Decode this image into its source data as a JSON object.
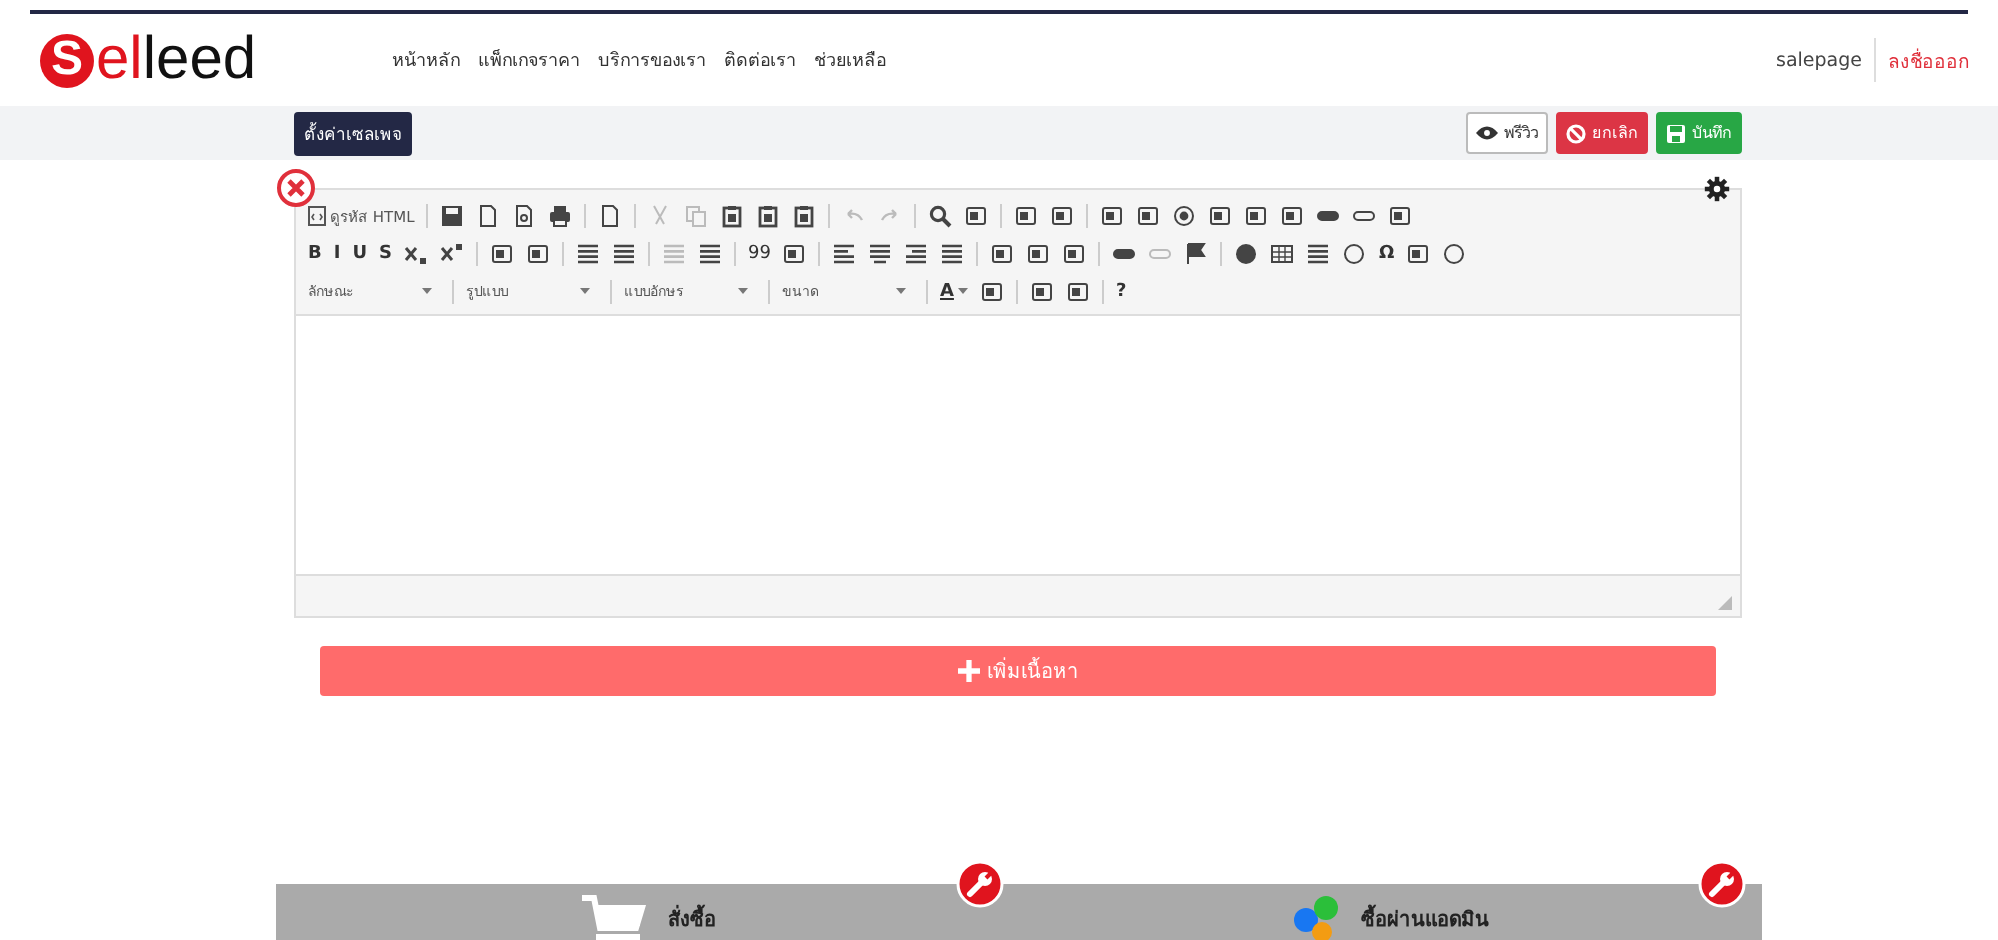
{
  "logo": {
    "badge": "S",
    "accent": "el",
    "rest": "leed"
  },
  "nav": [
    "หน้าหลัก",
    "แพ็กเกจราคา",
    "บริการของเรา",
    "ติดต่อเรา",
    "ช่วยเหลือ"
  ],
  "account": {
    "user": "salepage",
    "logout": "ลงชื่อออก"
  },
  "toolbar_bar": {
    "settings": "ตั้งค่าเซลเพจ",
    "actions": [
      {
        "kind": "preview",
        "label": "พรีวิว"
      },
      {
        "kind": "cancel",
        "label": "ยกเลิก"
      },
      {
        "kind": "save",
        "label": "บันทึก"
      }
    ]
  },
  "editor": {
    "rows": [
      [
        {
          "kind": "source",
          "label": "ดูรหัส HTML"
        },
        {
          "kind": "sep"
        },
        {
          "kind": "icon"
        },
        {
          "kind": "icon"
        },
        {
          "kind": "icon"
        },
        {
          "kind": "icon"
        },
        {
          "kind": "sep"
        },
        {
          "kind": "icon"
        },
        {
          "kind": "sep"
        },
        {
          "kind": "icon",
          "disabled": true
        },
        {
          "kind": "icon",
          "disabled": true
        },
        {
          "kind": "icon"
        },
        {
          "kind": "icon"
        },
        {
          "kind": "icon"
        },
        {
          "kind": "sep"
        },
        {
          "kind": "icon",
          "disabled": true
        },
        {
          "kind": "icon",
          "disabled": true
        },
        {
          "kind": "sep"
        },
        {
          "kind": "icon"
        },
        {
          "kind": "icon"
        },
        {
          "kind": "sep"
        },
        {
          "kind": "icon"
        },
        {
          "kind": "icon"
        },
        {
          "kind": "sep"
        },
        {
          "kind": "icon"
        },
        {
          "kind": "icon"
        },
        {
          "kind": "icon"
        },
        {
          "kind": "icon"
        },
        {
          "kind": "icon"
        },
        {
          "kind": "icon"
        },
        {
          "kind": "icon"
        },
        {
          "kind": "icon"
        },
        {
          "kind": "icon"
        }
      ],
      [
        {
          "kind": "text",
          "label": "B"
        },
        {
          "kind": "text",
          "label": "I"
        },
        {
          "kind": "text",
          "label": "U"
        },
        {
          "kind": "text",
          "label": "S"
        },
        {
          "kind": "icon"
        },
        {
          "kind": "icon"
        },
        {
          "kind": "sep"
        },
        {
          "kind": "icon"
        },
        {
          "kind": "icon"
        },
        {
          "kind": "sep"
        },
        {
          "kind": "icon"
        },
        {
          "kind": "icon"
        },
        {
          "kind": "sep"
        },
        {
          "kind": "icon",
          "disabled": true
        },
        {
          "kind": "icon"
        },
        {
          "kind": "sep"
        },
        {
          "kind": "text",
          "label": "99"
        },
        {
          "kind": "icon"
        },
        {
          "kind": "sep"
        },
        {
          "kind": "icon"
        },
        {
          "kind": "icon"
        },
        {
          "kind": "icon"
        },
        {
          "kind": "icon"
        },
        {
          "kind": "sep"
        },
        {
          "kind": "icon"
        },
        {
          "kind": "icon"
        },
        {
          "kind": "icon"
        },
        {
          "kind": "sep"
        },
        {
          "kind": "icon"
        },
        {
          "kind": "icon",
          "disabled": true
        },
        {
          "kind": "icon"
        },
        {
          "kind": "sep"
        },
        {
          "kind": "icon"
        },
        {
          "kind": "icon"
        },
        {
          "kind": "icon"
        },
        {
          "kind": "icon"
        },
        {
          "kind": "text",
          "label": "Ω"
        },
        {
          "kind": "icon"
        },
        {
          "kind": "icon"
        }
      ],
      [
        {
          "kind": "combo",
          "label": "ลักษณะ"
        },
        {
          "kind": "sep"
        },
        {
          "kind": "combo",
          "label": "รูปแบบ"
        },
        {
          "kind": "sep"
        },
        {
          "kind": "combo",
          "label": "แบบอักษร"
        },
        {
          "kind": "sep"
        },
        {
          "kind": "combo",
          "label": "ขนาด"
        },
        {
          "kind": "sep"
        },
        {
          "kind": "color",
          "label": "A"
        },
        {
          "kind": "icon"
        },
        {
          "kind": "sep"
        },
        {
          "kind": "icon"
        },
        {
          "kind": "icon"
        },
        {
          "kind": "sep"
        },
        {
          "kind": "text",
          "label": "?"
        }
      ]
    ]
  },
  "add_button": "เพิ่มเนื้อหา",
  "footer_items": [
    {
      "kind": "cart",
      "label": "สั่งซื้อ"
    },
    {
      "kind": "social",
      "label": "ซื้อผ่านแอดมิน"
    }
  ]
}
